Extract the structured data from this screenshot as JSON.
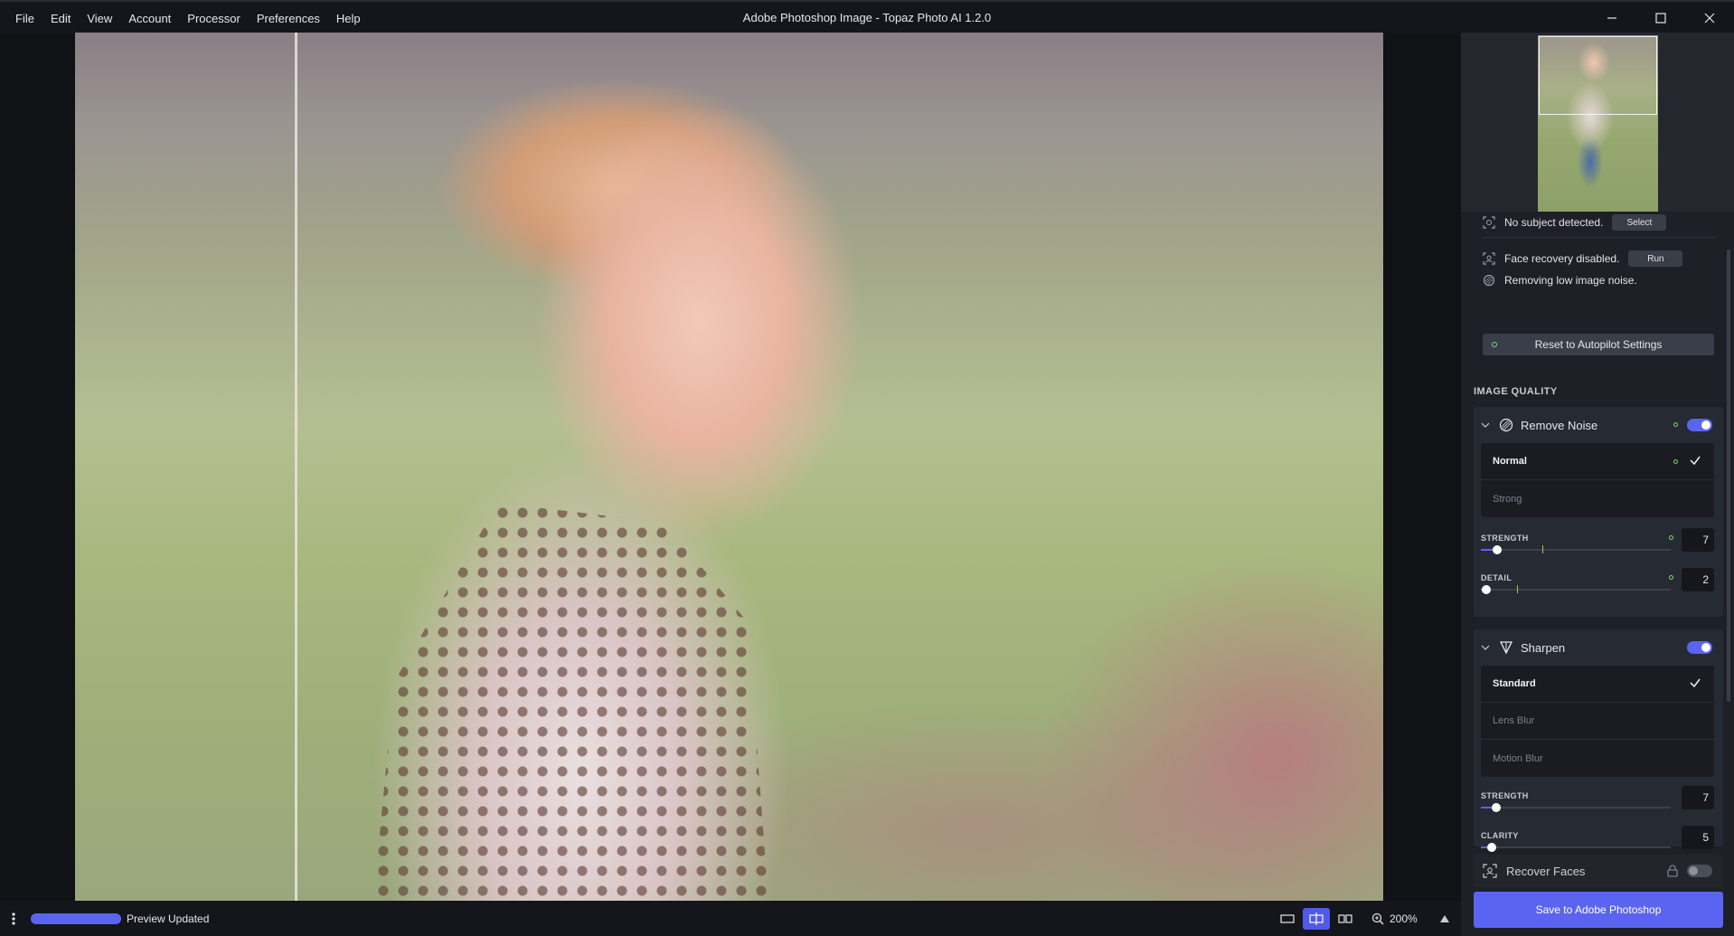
{
  "app": {
    "window_title": "Adobe Photoshop Image - Topaz Photo AI 1.2.0"
  },
  "menu": [
    "File",
    "Edit",
    "View",
    "Account",
    "Processor",
    "Preferences",
    "Help"
  ],
  "status": {
    "text": "Preview Updated",
    "progress": 1.0
  },
  "zoom": {
    "level": "200%"
  },
  "autopilot": {
    "subject": {
      "text": "No subject detected.",
      "button": "Select"
    },
    "face": {
      "text": "Face recovery disabled.",
      "button": "Run"
    },
    "noise": {
      "text": "Removing low image noise."
    },
    "reset_label": "Reset to Autopilot Settings"
  },
  "image_quality": {
    "title": "IMAGE QUALITY",
    "remove_noise": {
      "label": "Remove Noise",
      "enabled": true,
      "options": [
        "Normal",
        "Strong"
      ],
      "selected": "Normal",
      "strength": {
        "label": "STRENGTH",
        "value": "7"
      },
      "detail": {
        "label": "DETAIL",
        "value": "2"
      }
    },
    "sharpen": {
      "label": "Sharpen",
      "enabled": true,
      "options": [
        "Standard",
        "Lens Blur",
        "Motion Blur"
      ],
      "selected": "Standard",
      "strength": {
        "label": "STRENGTH",
        "value": "7"
      },
      "clarity": {
        "label": "CLARITY",
        "value": "5"
      }
    },
    "recover_faces": {
      "label": "Recover Faces",
      "enabled": false
    }
  },
  "save_label": "Save to Adobe Photoshop",
  "colors": {
    "accent": "#5b64f0",
    "autopilot_dot": "#7fd36e",
    "panel_bg": "#1d2027"
  }
}
